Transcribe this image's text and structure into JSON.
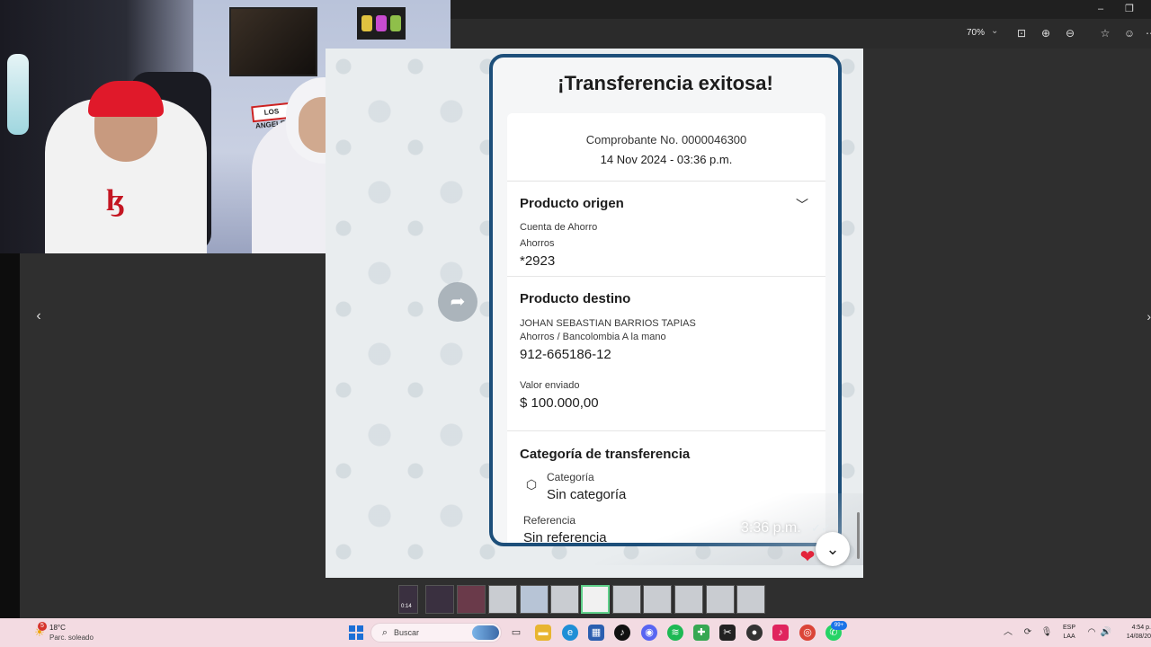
{
  "viewer": {
    "zoom": "70%",
    "nav_prev": "‹",
    "nav_next": "›"
  },
  "webcam": {
    "sign_text": "LOS ANGELES"
  },
  "receipt": {
    "title": "¡Transferencia exitosa!",
    "voucher": "Comprobante No. 0000046300",
    "datetime": "14 Nov 2024 - 03:36 p.m.",
    "origin": {
      "title": "Producto origen",
      "account_type": "Cuenta de Ahorro",
      "subtype": "Ahorros",
      "number": "*2923"
    },
    "destination": {
      "title": "Producto destino",
      "holder": "JOHAN SEBASTIAN BARRIOS TAPIAS",
      "type": "Ahorros / Bancolombia A la mano",
      "number": "912-665186-12",
      "amount_label": "Valor enviado",
      "amount": "$ 100.000,00"
    },
    "category": {
      "title": "Categoría de transferencia",
      "label": "Categoría",
      "value": "Sin categoría",
      "ref_label": "Referencia",
      "ref_value": "Sin referencia"
    }
  },
  "message": {
    "time": "3:36 p.m.",
    "ticks": "✓✓"
  },
  "filmstrip": {
    "video_duration": "0:14"
  },
  "taskbar": {
    "weather_badge": "5",
    "temperature": "18°C",
    "weather_desc": "Parc. soleado",
    "search_placeholder": "Buscar",
    "notification_badge": "99+",
    "lang_line1": "ESP",
    "lang_line2": "LAA",
    "time": "4:54 p.",
    "date": "14/08/20"
  }
}
